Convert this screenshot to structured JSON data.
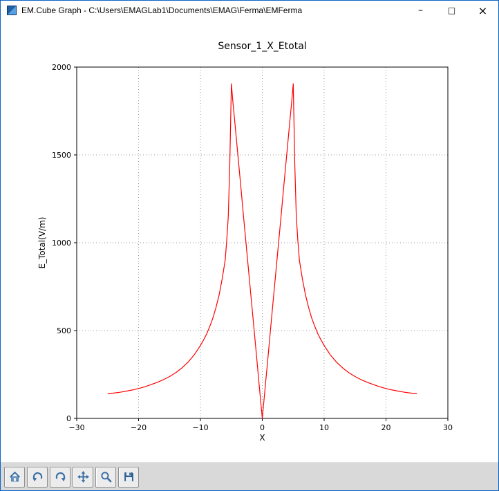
{
  "window": {
    "title": "EM.Cube Graph - C:\\Users\\EMAGLab1\\Documents\\EMAG\\Ferma\\EMFerma",
    "controls": {
      "minimize": "–",
      "maximize": "□",
      "close": "×"
    }
  },
  "colors": {
    "window_border": "#0a64c8",
    "toolbar_bg": "#d9d9d9",
    "icon_blue": "#3a6ea5",
    "grid": "#999999",
    "line": "#ff0000"
  },
  "toolbar": {
    "buttons": [
      {
        "icon": "home-icon"
      },
      {
        "icon": "back-icon"
      },
      {
        "icon": "forward-icon"
      },
      {
        "icon": "pan-icon"
      },
      {
        "icon": "zoom-icon"
      },
      {
        "icon": "save-icon"
      }
    ]
  },
  "chart_data": {
    "type": "line",
    "title": "Sensor_1_X_Etotal",
    "xlabel": "X",
    "ylabel": "E_Total(V/m)",
    "xlim": [
      -30,
      30
    ],
    "ylim": [
      0,
      2000
    ],
    "xticks": [
      -30,
      -20,
      -10,
      0,
      10,
      20,
      30
    ],
    "xtick_labels": [
      "−30",
      "−20",
      "−10",
      "0",
      "10",
      "20",
      "30"
    ],
    "yticks": [
      0,
      500,
      1000,
      1500,
      2000
    ],
    "ytick_labels": [
      "0",
      "500",
      "1000",
      "1500",
      "2000"
    ],
    "grid": true,
    "legend": "none",
    "line_color": "#ff0000",
    "series": [
      {
        "name": "Sensor_1_X_Etotal",
        "x": [
          -25,
          -24,
          -23,
          -22,
          -21,
          -20,
          -19,
          -18,
          -17,
          -16,
          -15,
          -14,
          -13,
          -12,
          -11,
          -10,
          -9.5,
          -9,
          -8.5,
          -8,
          -7.5,
          -7,
          -6.5,
          -6,
          -5.75,
          -5.5,
          -5.25,
          -5,
          -4.75,
          -4.5,
          -4,
          -3.5,
          -3,
          -2.5,
          -2,
          -1.5,
          -1,
          -0.5,
          0,
          0.5,
          1,
          1.5,
          2,
          2.5,
          3,
          3.5,
          4,
          4.5,
          4.75,
          5,
          5.25,
          5.5,
          5.75,
          6,
          6.5,
          7,
          7.5,
          8,
          8.5,
          9,
          9.5,
          10,
          11,
          12,
          13,
          14,
          15,
          16,
          17,
          18,
          19,
          20,
          21,
          22,
          23,
          24,
          25
        ],
        "y": [
          140,
          144,
          149,
          155,
          162,
          170,
          180,
          192,
          205,
          220,
          238,
          260,
          287,
          320,
          362,
          415,
          446,
          480,
          522,
          570,
          630,
          700,
          790,
          900,
          1010,
          1150,
          1450,
          1905,
          1800,
          1710,
          1520,
          1330,
          1140,
          950,
          760,
          570,
          380,
          190,
          0,
          190,
          380,
          570,
          760,
          950,
          1140,
          1330,
          1520,
          1710,
          1800,
          1905,
          1450,
          1150,
          1010,
          900,
          790,
          700,
          630,
          570,
          522,
          480,
          446,
          415,
          362,
          320,
          287,
          260,
          238,
          220,
          205,
          192,
          180,
          170,
          162,
          155,
          149,
          144,
          140
        ]
      }
    ]
  }
}
